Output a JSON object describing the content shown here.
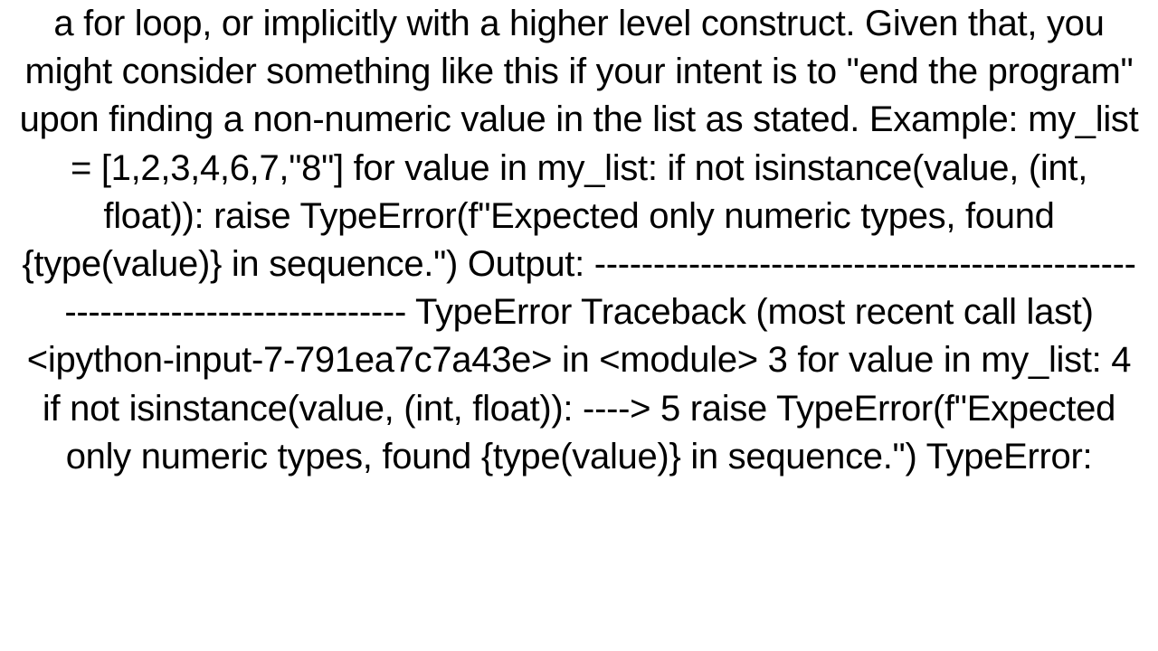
{
  "document": {
    "text": "a for loop, or implicitly with a higher level construct. Given that, you might consider something like this if your intent is to \"end the program\" upon finding a non-numeric value in the list as stated. Example: my_list = [1,2,3,4,6,7,\"8\"]  for value in my_list:     if not isinstance(value, (int, float)):         raise TypeError(f\"Expected only numeric types, found {type(value)} in sequence.\")  Output: --------------------------------------------------------------------------- TypeError                                 Traceback (most recent call last) <ipython-input-7-791ea7c7a43e> in <module>       3 for value in my_list:       4     if not isinstance(value, (int, float)): ----> 5         raise TypeError(f\"Expected only numeric types, found {type(value)} in sequence.\")  TypeError:"
  }
}
